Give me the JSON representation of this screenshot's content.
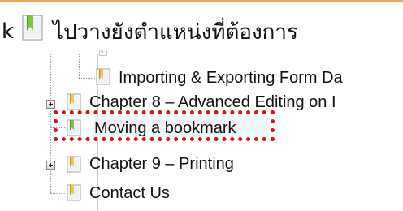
{
  "instruction": {
    "lead_text": "k",
    "text": "ไปวางยังตำแหน่งที่ต้องการ"
  },
  "tree": {
    "items": [
      {
        "label": "Importing & Exporting Form Da",
        "icon": "bookmark-icon",
        "expander": false
      },
      {
        "label": "Chapter 8 – Advanced Editing on I",
        "icon": "bookmark-icon",
        "expander": true
      },
      {
        "label": "Moving a bookmark",
        "icon": "bookmark-icon-green",
        "expander": false,
        "highlighted": true
      },
      {
        "label": "Chapter 9 – Printing",
        "icon": "bookmark-icon",
        "expander": true
      },
      {
        "label": "Contact Us",
        "icon": "bookmark-icon",
        "expander": false
      }
    ]
  },
  "colors": {
    "highlight_border": "#d8121a",
    "top_rule": "#f2a65a",
    "bookmark_yellow": "#f3c552",
    "bookmark_green": "#7cc243"
  }
}
